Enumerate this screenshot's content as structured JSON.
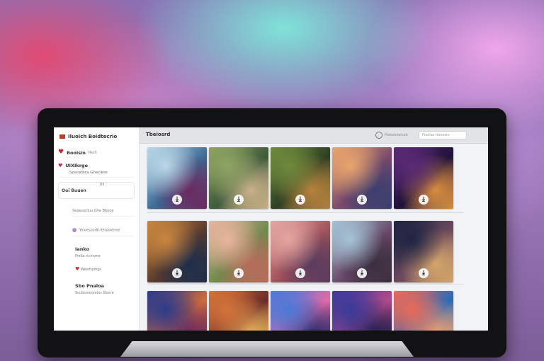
{
  "sidebar": {
    "brand": "Iluoich Boidtecrio",
    "sections": [
      {
        "label": "Booisin",
        "sub": "Reilt",
        "items": [
          "UIXIkrge",
          "Soscetbra Gheclere"
        ]
      }
    ],
    "pill": {
      "label": "Ooi Buuen",
      "value": "83"
    },
    "rows": [
      "Sepesoriluu Ghe Bbooe",
      "Yoloesoodh Kenaoenee"
    ],
    "blocks": [
      {
        "title": "Ianko",
        "sub": "Ponle ricirnme"
      },
      {
        "title": "",
        "sub": "Wesrhpirigs"
      },
      {
        "title": "Sbo Pnaloa",
        "sub": "Scubsonnpotoc Bosce"
      }
    ]
  },
  "topbar": {
    "title": "Tbeiosrd",
    "user_label": "Poouieesicoit",
    "search_placeholder": "Foollas tlonesio"
  },
  "gallery": {
    "rows": [
      [
        {
          "name": "white-dragon-art",
          "colors": [
            "#b9d7e8",
            "#3c6a95",
            "#6b2a5e"
          ]
        },
        {
          "name": "forest-creature-art",
          "colors": [
            "#8fa463",
            "#3d5a3a",
            "#c8b089"
          ]
        },
        {
          "name": "jungle-shaman-art",
          "colors": [
            "#6f8a3c",
            "#2d3f23",
            "#b6823c"
          ]
        },
        {
          "name": "desert-tentacle-art",
          "colors": [
            "#e9a56d",
            "#7a4a6b",
            "#3b3e6f"
          ]
        },
        {
          "name": "purple-fireflies-art",
          "colors": [
            "#5b2a76",
            "#1f123a",
            "#d88d3e"
          ]
        }
      ],
      [
        {
          "name": "clockwork-tower-art",
          "colors": [
            "#c9863f",
            "#5a3b2e",
            "#1e2e4a"
          ]
        },
        {
          "name": "cactus-garden-art",
          "colors": [
            "#e9b59d",
            "#6e8a4d",
            "#b86b5b"
          ]
        },
        {
          "name": "sitting-golem-art",
          "colors": [
            "#e5a5a0",
            "#a0525a",
            "#5a3b5e"
          ]
        },
        {
          "name": "ruined-warrior-art",
          "colors": [
            "#a5c3d6",
            "#6a4a6a",
            "#3b2e3e"
          ]
        },
        {
          "name": "night-lanterns-art",
          "colors": [
            "#1e2442",
            "#6e4a5e",
            "#d4a66a"
          ]
        }
      ],
      [
        {
          "name": "cosmic-tree-art",
          "colors": [
            "#2c3b8a",
            "#d06a3a",
            "#6a2a5e"
          ]
        },
        {
          "name": "autumn-battle-art",
          "colors": [
            "#d4743a",
            "#6a2a2a",
            "#e8b45a"
          ]
        },
        {
          "name": "blue-storm-art",
          "colors": [
            "#4a7ad8",
            "#e06aa8",
            "#2a2a6a"
          ]
        },
        {
          "name": "violet-mountain-art",
          "colors": [
            "#3a3a9a",
            "#b24a8a",
            "#1e1e4a"
          ]
        },
        {
          "name": "coral-reef-art",
          "colors": [
            "#e86a5a",
            "#2a6ab8",
            "#f2a070"
          ]
        }
      ]
    ]
  }
}
